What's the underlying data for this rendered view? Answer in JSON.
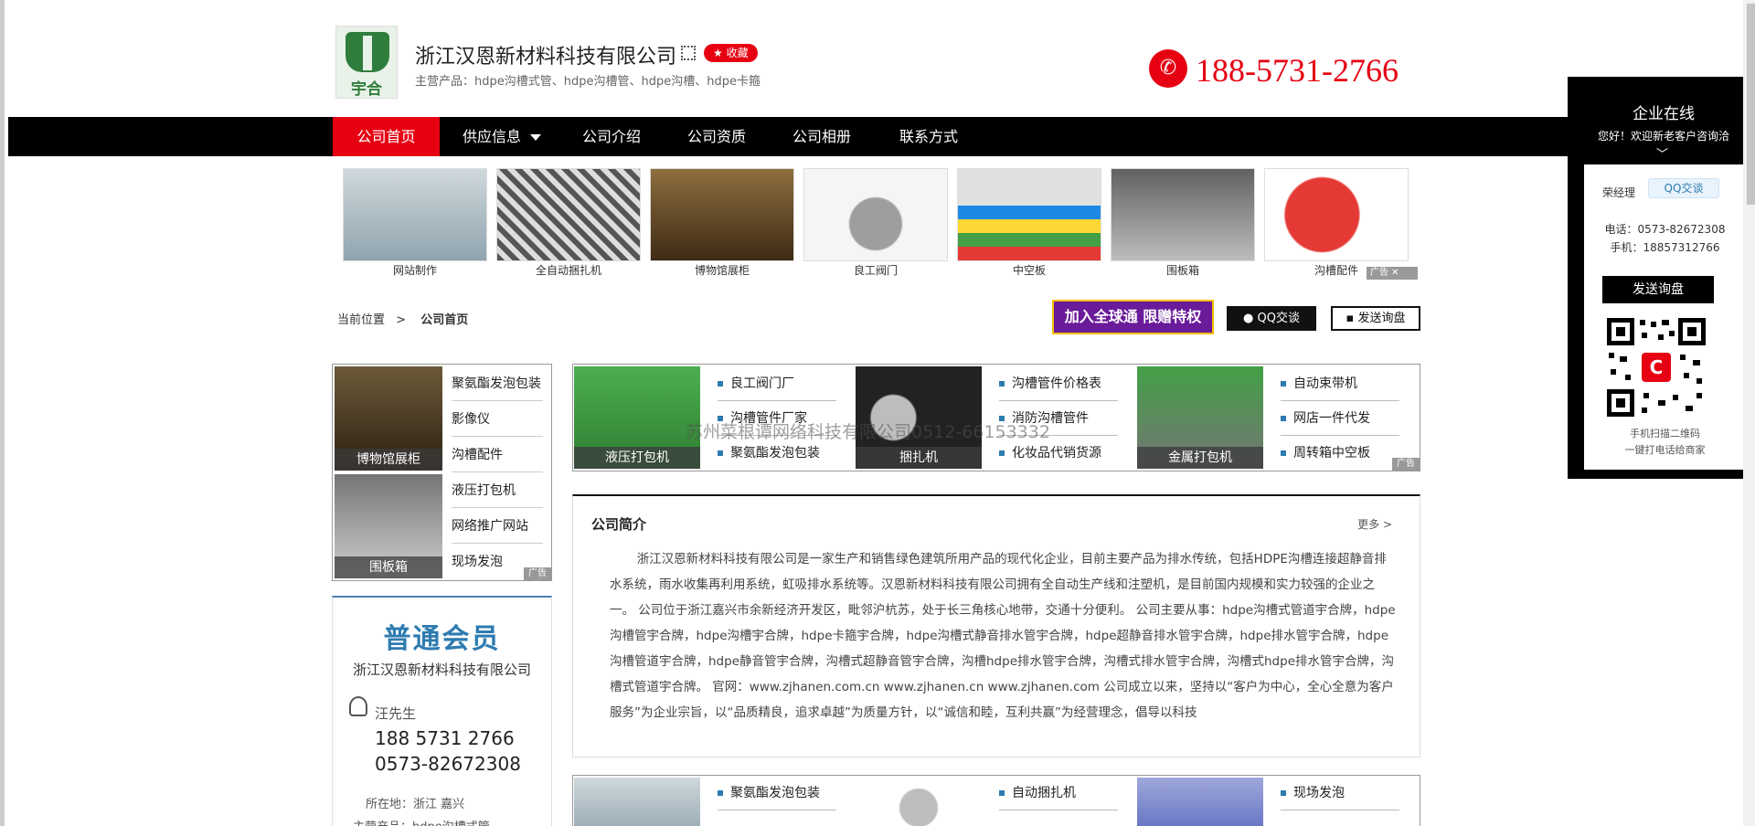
{
  "header": {
    "logo_text": "宇合",
    "company_name": "浙江汉恩新材料科技有限公司",
    "favorite_label": "★ 收藏",
    "main_products": "主营产品：hdpe沟槽式管、hdpe沟槽管、hdpe沟槽、hdpe卡箍",
    "phone": "188-5731-2766"
  },
  "nav": {
    "items": [
      {
        "label": "公司首页"
      },
      {
        "label": "供应信息"
      },
      {
        "label": "公司介绍"
      },
      {
        "label": "公司资质"
      },
      {
        "label": "公司相册"
      },
      {
        "label": "联系方式"
      }
    ]
  },
  "ad_strip": {
    "items": [
      {
        "caption": "网站制作"
      },
      {
        "caption": "全自动捆扎机"
      },
      {
        "caption": "博物馆展柜"
      },
      {
        "caption": "良工阀门"
      },
      {
        "caption": "中空板"
      },
      {
        "caption": "围板箱"
      },
      {
        "caption": "沟槽配件"
      }
    ],
    "tag": "广告 ✕"
  },
  "breadcrumb": {
    "prefix": "当前位置",
    "sep": ">",
    "current": "公司首页"
  },
  "actions": {
    "global_label": "加入全球通 限赠特权",
    "qq_label": "QQ交谈",
    "inquiry_label": "发送询盘"
  },
  "left_ad": {
    "images": [
      {
        "label": "博物馆展柜"
      },
      {
        "label": "围板箱"
      }
    ],
    "links": [
      "聚氨酯发泡包装",
      "影像仪",
      "沟槽配件",
      "液压打包机",
      "网络推广网站",
      "现场发泡"
    ],
    "tag": "广告"
  },
  "member": {
    "badge": "普通会员",
    "company": "浙江汉恩新材料科技有限公司",
    "contact_name": "汪先生",
    "mobile": "188 5731 2766",
    "tel": "0573-82672308",
    "location": "所在地：浙江 嘉兴",
    "products": "主营产品：hdpe沟槽式管"
  },
  "mid_ad": {
    "groups": [
      {
        "image_label": "液压打包机",
        "links": [
          "良工阀门厂",
          "沟槽管件厂家",
          "聚氨酯发泡包装"
        ]
      },
      {
        "image_label": "捆扎机",
        "links": [
          "沟槽管件价格表",
          "消防沟槽管件",
          "化妆品代销货源"
        ]
      },
      {
        "image_label": "金属打包机",
        "links": [
          "自动束带机",
          "网店一件代发",
          "周转箱中空板"
        ]
      }
    ],
    "tag": "广告"
  },
  "watermark": "苏州菜根谭网络科技有限公司0512-66153332",
  "intro": {
    "title": "公司简介",
    "more": "更多 >",
    "body": "浙江汉恩新材料科技有限公司是一家生产和销售绿色建筑所用产品的现代化企业，目前主要产品为排水传统，包括HDPE沟槽连接超静音排水系统，雨水收集再利用系统，虹吸排水系统等。汉恩新材料科技有限公司拥有全自动生产线和注塑机，是目前国内规模和实力较强的企业之一。 公司位于浙江嘉兴市余新经济开发区，毗邻沪杭苏，处于长三角核心地带，交通十分便利。 公司主要从事：hdpe沟槽式管道宇合牌，hdpe沟槽管宇合牌，hdpe沟槽宇合牌，hdpe卡箍宇合牌，hdpe沟槽式静音排水管宇合牌，hdpe超静音排水管宇合牌，hdpe排水管宇合牌，hdpe沟槽管道宇合牌，hdpe静音管宇合牌，沟槽式超静音管宇合牌，沟槽hdpe排水管宇合牌，沟槽式排水管宇合牌，沟槽式hdpe排水管宇合牌，沟槽式管道宇合牌。 官网：www.zjhanen.com.cn www.zjhanen.cn www.zjhanen.com 公司成立以来，坚持以“客户为中心，全心全意为客户服务”为企业宗旨，以“品质精良，追求卓越”为质量方针，以“诚信和睦，互利共赢”为经营理念，倡导以科技"
  },
  "bottom_ad": {
    "links": [
      "聚氨酯发泡包装",
      "自动捆扎机",
      "现场发泡"
    ]
  },
  "side_panel": {
    "title": "企业在线",
    "subtitle": "您好！欢迎新老客户咨询洽",
    "manager": "荣经理",
    "qq_label": "QQ交谈",
    "tel": "电话：0573-82672308",
    "mobile": "手机：18857312766",
    "inquiry_label": "发送询盘",
    "note1": "手机扫描二维码",
    "note2": "一键打电话给商家"
  },
  "colors": {
    "accent": "#e60012",
    "nav_bg": "#000000",
    "member_blue": "#2e7bb0"
  }
}
